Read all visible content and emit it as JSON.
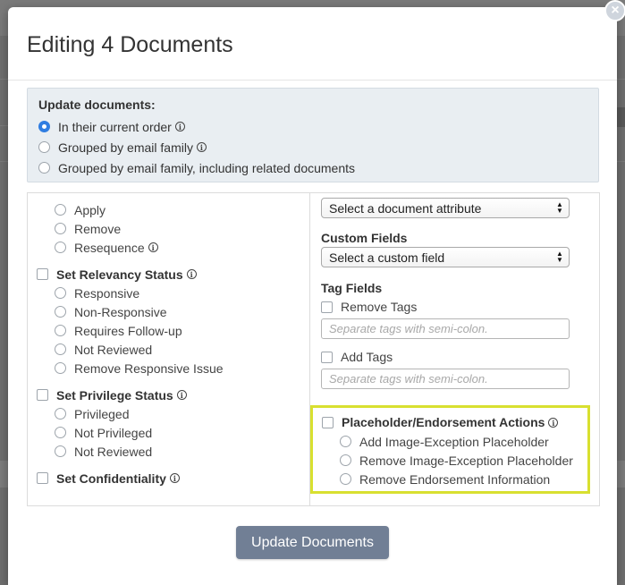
{
  "modal": {
    "title": "Editing 4 Documents",
    "close_glyph": "×"
  },
  "update": {
    "heading": "Update documents:",
    "options": [
      {
        "label": "In their current order",
        "selected": true,
        "info": true
      },
      {
        "label": "Grouped by email family",
        "selected": false,
        "info": true
      },
      {
        "label": "Grouped by email family, including related documents",
        "selected": false,
        "info": false
      }
    ]
  },
  "left": {
    "top_options": [
      "Apply",
      "Remove",
      "Resequence"
    ],
    "relevancy": {
      "label": "Set Relevancy Status",
      "options": [
        "Responsive",
        "Non-Responsive",
        "Requires Follow-up",
        "Not Reviewed",
        "Remove Responsive Issue"
      ]
    },
    "privilege": {
      "label": "Set Privilege Status",
      "options": [
        "Privileged",
        "Not Privileged",
        "Not Reviewed"
      ]
    },
    "confidentiality": {
      "label": "Set Confidentiality"
    }
  },
  "right": {
    "doc_attr_select": "Select a document attribute",
    "custom_fields_label": "Custom Fields",
    "custom_field_select": "Select a custom field",
    "tag_fields_label": "Tag Fields",
    "remove_tags_label": "Remove Tags",
    "remove_tags_placeholder": "Separate tags with semi-colon.",
    "add_tags_label": "Add Tags",
    "add_tags_placeholder": "Separate tags with semi-colon."
  },
  "placeholder": {
    "label": "Placeholder/Endorsement Actions",
    "options": [
      "Add Image-Exception Placeholder",
      "Remove Image-Exception Placeholder",
      "Remove Endorsement Information"
    ]
  },
  "footer": {
    "submit_label": "Update Documents"
  },
  "colors": {
    "primary_button": "#717f95",
    "highlight": "#d8e030",
    "radio_selected": "#2f7de1",
    "update_box_bg": "#e9eef2"
  },
  "icons": {
    "info": "info-circle-icon",
    "close": "close-icon",
    "select_arrows": "select-arrows-icon"
  }
}
